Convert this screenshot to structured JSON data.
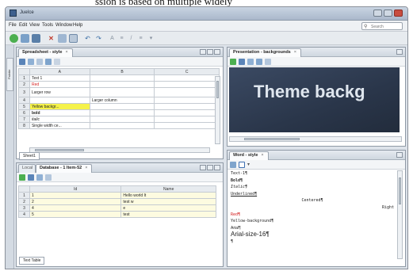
{
  "caption": "ssion is based on multiple widely",
  "window": {
    "title": "JueIce"
  },
  "menu": [
    "File",
    "Edit",
    "View",
    "Tools",
    "Window",
    "Help"
  ],
  "search": {
    "placeholder": "Search"
  },
  "leftstrip": {
    "label": "Palette"
  },
  "spreadsheet": {
    "tab": "Spreadsheet - style",
    "columns": [
      "A",
      "B",
      "C"
    ],
    "rows": [
      {
        "n": "1",
        "a": "Text 1",
        "b": ""
      },
      {
        "n": "2",
        "a": "Red",
        "b": ""
      },
      {
        "n": "3",
        "a": "Larger row",
        "b": ""
      },
      {
        "n": "4",
        "a": "",
        "b": "Larger column"
      },
      {
        "n": "5",
        "a": "Yellow backgr...",
        "b": ""
      },
      {
        "n": "6",
        "a": "bold",
        "b": ""
      },
      {
        "n": "7",
        "a": "italic",
        "b": ""
      },
      {
        "n": "8",
        "a": "Single width ce...",
        "b": ""
      }
    ],
    "sheet_tab": "Sheet1"
  },
  "database": {
    "tab": "Database - 1 Item-52",
    "tab_prefix": "Local",
    "columns": [
      "Id",
      "Name"
    ],
    "rows": [
      {
        "n": "1",
        "id": "1",
        "name": "Hello world It"
      },
      {
        "n": "2",
        "id": "2",
        "name": "test w"
      },
      {
        "n": "3",
        "id": "4",
        "name": "e"
      },
      {
        "n": "4",
        "id": "5",
        "name": "test"
      }
    ],
    "bottom_tab": "Text Table"
  },
  "presentation": {
    "tab": "Presentation - backgrounds",
    "slide_text": "Theme backg"
  },
  "word": {
    "tab": "Word - style",
    "lines": [
      {
        "text": "Text-1¶",
        "style": "normal"
      },
      {
        "text": "Bold¶",
        "style": "bold"
      },
      {
        "text": "Italic¶",
        "style": "italic"
      },
      {
        "text": "Underlined¶",
        "style": "underline"
      },
      {
        "text": "Centered¶",
        "style": "center"
      },
      {
        "text": "Right",
        "style": "right"
      },
      {
        "text": "Red¶",
        "style": "red"
      },
      {
        "text": "Yellow-background¶",
        "style": "yellow"
      },
      {
        "text": "Arial¶",
        "style": "arial"
      },
      {
        "text": "Arial-size-16¶",
        "style": "large"
      },
      {
        "text": "¶",
        "style": "normal"
      }
    ]
  },
  "colors": {
    "accent": "#3d5f8e",
    "yellow_cell": "#f5f24a",
    "red_text": "#d42020",
    "slide_bg": "#2a364a"
  }
}
